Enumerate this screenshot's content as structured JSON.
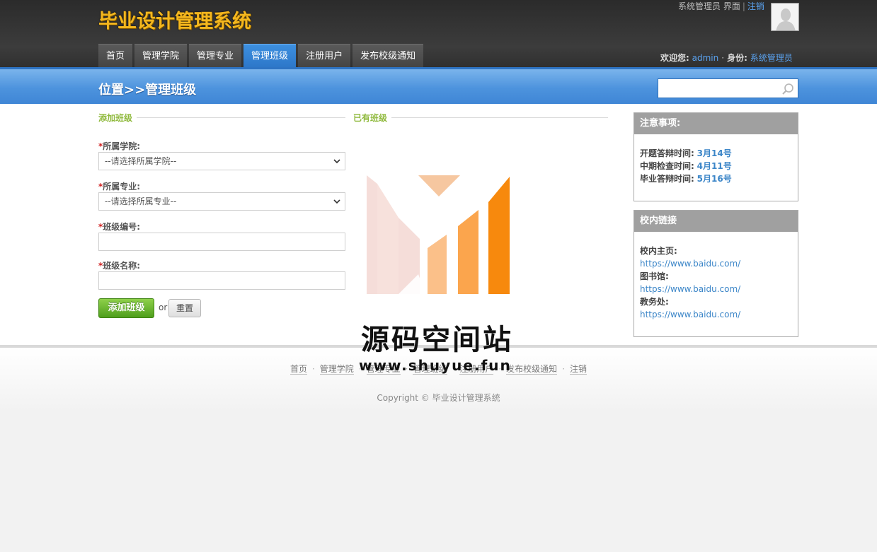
{
  "header": {
    "site_title": "毕业设计管理系统",
    "top_links": {
      "role_page": "系统管理员 界面",
      "separator": "|",
      "logout": "注销"
    },
    "nav": [
      {
        "label": "首页",
        "active": false
      },
      {
        "label": "管理学院",
        "active": false
      },
      {
        "label": "管理专业",
        "active": false
      },
      {
        "label": "管理班级",
        "active": true
      },
      {
        "label": "注册用户",
        "active": false
      },
      {
        "label": "发布校级通知",
        "active": false
      }
    ],
    "welcome": {
      "label": "欢迎您:",
      "user": "admin",
      "dot": "·",
      "role_label": "身份:",
      "role": "系统管理员"
    }
  },
  "band": {
    "breadcrumb": "位置>>管理班级",
    "search": {
      "value": "",
      "placeholder": ""
    }
  },
  "main": {
    "add_section_title": "添加班级",
    "existing_section_title": "已有班级",
    "required_mark": "*",
    "fields": {
      "college": {
        "label": "所属学院:",
        "value": "--请选择所属学院--"
      },
      "major": {
        "label": "所属专业:",
        "value": "--请选择所属专业--"
      },
      "class_no": {
        "label": "班级编号:",
        "value": ""
      },
      "class_name": {
        "label": "班级名称:",
        "value": ""
      }
    },
    "buttons": {
      "add": "添加班级",
      "or": "or",
      "reset": "重置"
    }
  },
  "sidebar": {
    "notice": {
      "title": "注意事项:",
      "items": [
        {
          "label": "开题答辩时间:",
          "value": "3月14号"
        },
        {
          "label": "中期检查时间:",
          "value": "4月11号"
        },
        {
          "label": "毕业答辩时间:",
          "value": "5月16号"
        }
      ]
    },
    "links": {
      "title": "校内链接",
      "items": [
        {
          "label": "校内主页:",
          "url": "https://www.baidu.com/"
        },
        {
          "label": "图书馆:",
          "url": "https://www.baidu.com/"
        },
        {
          "label": "教务处:",
          "url": "https://www.baidu.com/"
        }
      ]
    }
  },
  "watermark": {
    "name": "源码空间站",
    "site": "www.shuyue.fun"
  },
  "footer": {
    "links": [
      "首页",
      "管理学院",
      "管理专业",
      "管理班级",
      "注册用户",
      "发布校级通知",
      "注销"
    ],
    "separator": "·",
    "copyright": "Copyright © 毕业设计管理系统"
  },
  "colors": {
    "accent_blue": "#3f86d6",
    "title_gold": "#f4b71e",
    "add_green": "#5aa822",
    "link_blue": "#3c86c8"
  }
}
